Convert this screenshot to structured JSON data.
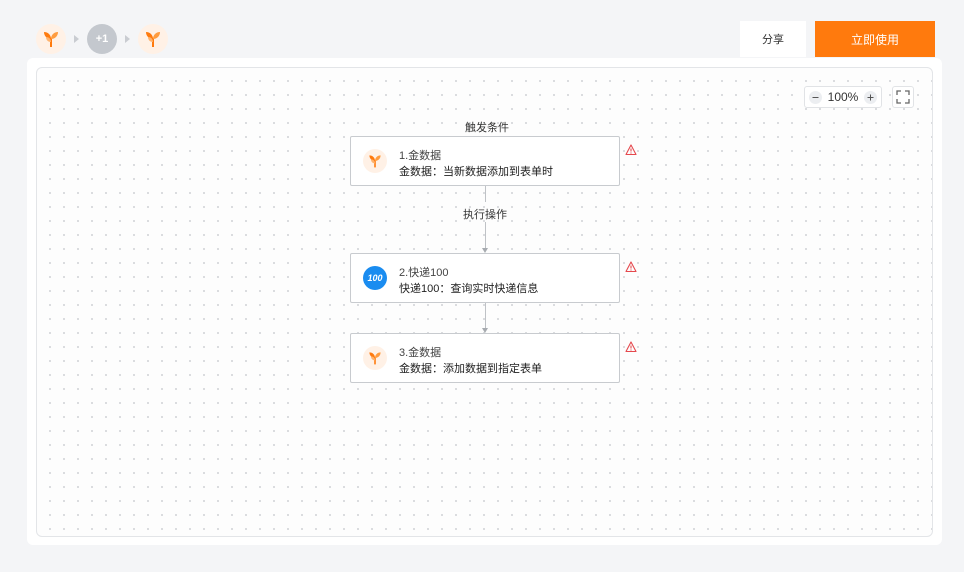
{
  "header": {
    "more_apps_label": "+1",
    "share_label": "分享",
    "use_label": "立即使用"
  },
  "toolbar": {
    "zoom_value": "100%"
  },
  "flow": {
    "trigger_label": "触发条件",
    "action_label": "执行操作",
    "nodes": [
      {
        "title": "1.金数据",
        "desc": "金数据：当新数据添加到表单时",
        "icon": "jinshuju-icon"
      },
      {
        "title": "2.快递100",
        "desc": "快递100：查询实时快递信息",
        "icon": "kuaidi100-icon"
      },
      {
        "title": "3.金数据",
        "desc": "金数据：添加数据到指定表单",
        "icon": "jinshuju-icon"
      }
    ]
  },
  "colors": {
    "accent": "#ff7a0d",
    "warning": "#e5484d",
    "kuaidi_blue": "#1a8cf0"
  }
}
